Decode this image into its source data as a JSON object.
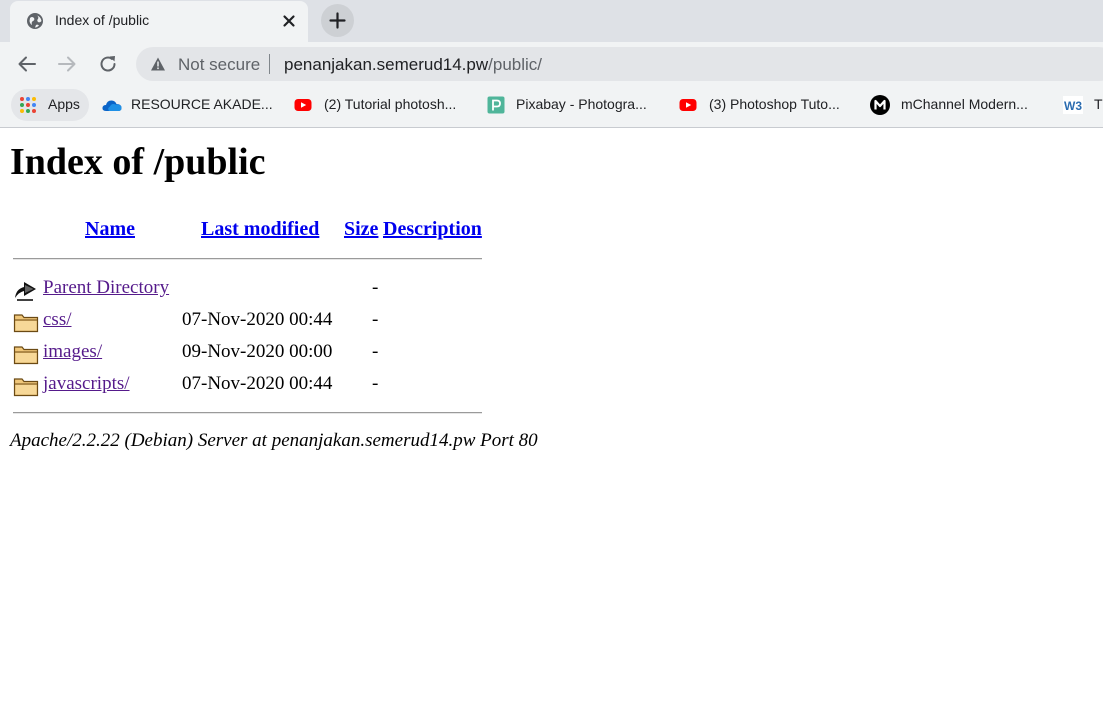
{
  "browser": {
    "tab": {
      "title": "Index of /public",
      "icon": "globe-icon"
    },
    "new_tab_icon": "plus-icon",
    "nav": {
      "back": "back-arrow-icon",
      "forward": "forward-arrow-icon",
      "reload": "reload-icon"
    },
    "omnibox": {
      "security_label": "Not secure",
      "url_host": "penanjakan.semerud14.pw",
      "url_path": "/public/"
    },
    "bookmarks": [
      {
        "label": "Apps",
        "icon": "apps-grid-icon"
      },
      {
        "label": "RESOURCE AKADE...",
        "icon": "onedrive-cloud-icon"
      },
      {
        "label": "(2) Tutorial photosh...",
        "icon": "youtube-icon"
      },
      {
        "label": "Pixabay - Photogra...",
        "icon": "pixabay-icon"
      },
      {
        "label": "(3) Photoshop Tuto...",
        "icon": "youtube-icon"
      },
      {
        "label": "mChannel Modern...",
        "icon": "mchannel-icon"
      },
      {
        "label": "Tl",
        "icon": "w3schools-icon"
      }
    ],
    "colors": {
      "youtube_red": "#ff0000",
      "pixabay_green": "#4fb59a",
      "link_blue": "#0000ee",
      "visited_purple": "#551a8b"
    }
  },
  "page": {
    "title": "Index of /public",
    "columns": {
      "name": "Name",
      "last_modified": "Last modified",
      "size": "Size",
      "description": "Description"
    },
    "rows": [
      {
        "name": "Parent Directory",
        "date": "",
        "size": "-",
        "icon": "parent-directory-icon"
      },
      {
        "name": "css/",
        "date": "07-Nov-2020 00:44",
        "size": "-",
        "icon": "folder-icon"
      },
      {
        "name": "images/",
        "date": "09-Nov-2020 00:00",
        "size": "-",
        "icon": "folder-icon"
      },
      {
        "name": "javascripts/",
        "date": "07-Nov-2020 00:44",
        "size": "-",
        "icon": "folder-icon"
      }
    ],
    "address": "Apache/2.2.22 (Debian) Server at penanjakan.semerud14.pw Port 80"
  }
}
